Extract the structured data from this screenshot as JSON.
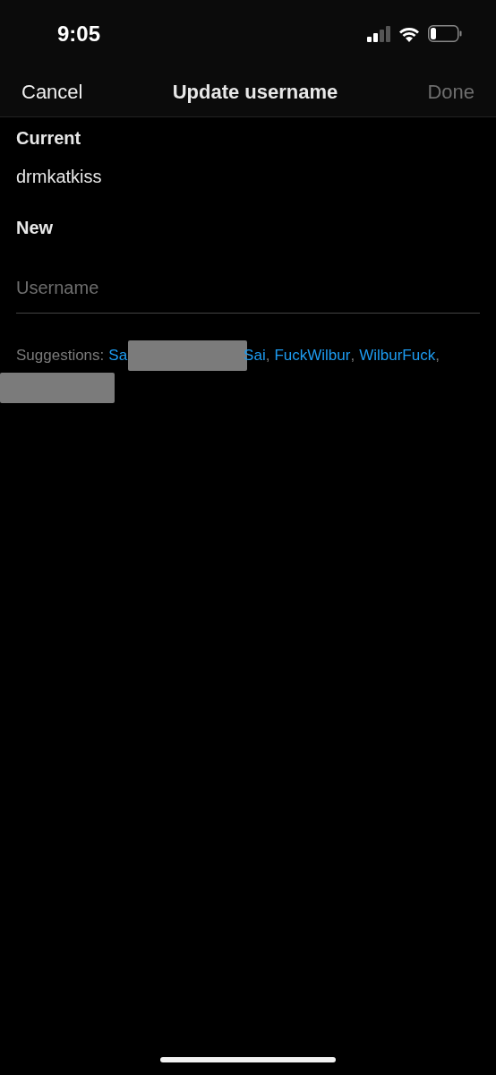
{
  "status_bar": {
    "time": "9:05"
  },
  "nav_bar": {
    "cancel": "Cancel",
    "title": "Update username",
    "done": "Done",
    "done_disabled": true
  },
  "current": {
    "label": "Current",
    "value": "drmkatkiss"
  },
  "new": {
    "label": "New",
    "placeholder": "Username"
  },
  "suggestions": {
    "label": "Suggestions:",
    "items": [
      {
        "kind": "link",
        "text": "Sa"
      },
      {
        "kind": "redacted"
      },
      {
        "kind": "link",
        "text": "Sai"
      },
      {
        "kind": "separator",
        "text": ","
      },
      {
        "kind": "link",
        "text": "FuckWilbur"
      },
      {
        "kind": "separator",
        "text": ","
      },
      {
        "kind": "link",
        "text": "WilburFuck"
      },
      {
        "kind": "separator",
        "text": ","
      },
      {
        "kind": "redacted_block"
      }
    ]
  }
}
